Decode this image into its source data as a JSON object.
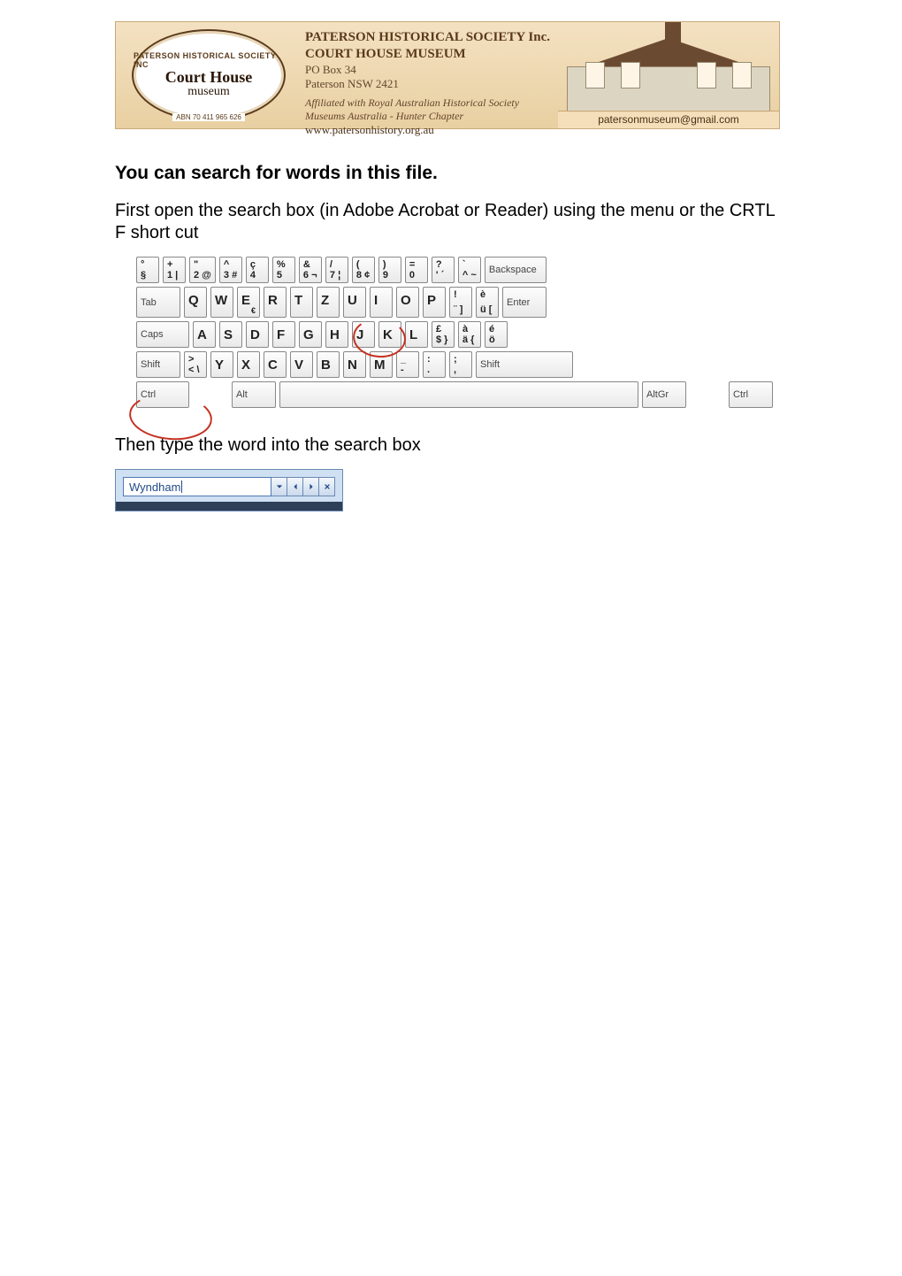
{
  "banner": {
    "badge": {
      "arc_top": "PATERSON HISTORICAL SOCIETY INC",
      "main": "Court House",
      "sub": "museum",
      "abn": "ABN 70 411 965 626"
    },
    "title1": "PATERSON HISTORICAL SOCIETY Inc.",
    "title2": "COURT HOUSE MUSEUM",
    "addr1": "PO Box 34",
    "addr2": "Paterson NSW 2421",
    "aff1": "Affiliated with Royal Australian Historical Society",
    "aff2": "Museums Australia - Hunter Chapter",
    "url": "www.patersonhistory.org.au",
    "email": "patersonmuseum@gmail.com"
  },
  "heading": "You can search for words in this file.",
  "para1": "First open the search box (in Adobe Acrobat or Reader) using the menu or the CRTL F short cut",
  "para2": "Then type the word into the search box",
  "keyboard": {
    "row1": [
      {
        "top": "°",
        "bot": "§"
      },
      {
        "top": "+",
        "bot": "1 |"
      },
      {
        "top": "\"",
        "bot": "2 @"
      },
      {
        "top": "^",
        "bot": "3 #"
      },
      {
        "top": "ç",
        "bot": "4"
      },
      {
        "top": "%",
        "bot": "5"
      },
      {
        "top": "&",
        "bot": "6 ¬"
      },
      {
        "top": "/",
        "bot": "7 ¦"
      },
      {
        "top": "(",
        "bot": "8 ¢"
      },
      {
        "top": ")",
        "bot": "9"
      },
      {
        "top": "=",
        "bot": "0"
      },
      {
        "top": "?",
        "bot": "' ´"
      },
      {
        "top": "`",
        "bot": "^ ~"
      }
    ],
    "backspace": "Backspace",
    "tab": "Tab",
    "row2": [
      "Q",
      "W",
      "E",
      "R",
      "T",
      "Z",
      "U",
      "I",
      "O",
      "P"
    ],
    "row2_extra": [
      {
        "top": "è",
        "bot": "ü ["
      },
      {
        "top": "!",
        "bot": "¨ ]"
      }
    ],
    "row2_e_suffix": "€",
    "enter": "Enter",
    "caps": "Caps",
    "row3": [
      "A",
      "S",
      "D",
      "F",
      "G",
      "H",
      "J",
      "K",
      "L"
    ],
    "row3_extra": [
      {
        "top": "é",
        "bot": "ö"
      },
      {
        "top": "à",
        "bot": "ä {"
      },
      {
        "top": "£",
        "bot": "$ }"
      }
    ],
    "shift_l": "Shift",
    "row4_first": {
      "top": ">",
      "bot": "< \\"
    },
    "row4": [
      "Y",
      "X",
      "C",
      "V",
      "B",
      "N",
      "M"
    ],
    "row4_extra": [
      {
        "top": ";",
        "bot": ","
      },
      {
        "top": ":",
        "bot": "."
      },
      {
        "top": "_",
        "bot": "-"
      }
    ],
    "shift_r": "Shift",
    "ctrl_l": "Ctrl",
    "alt": "Alt",
    "altgr": "AltGr",
    "ctrl_r": "Ctrl"
  },
  "searchbox": {
    "value": "Wyndham"
  }
}
